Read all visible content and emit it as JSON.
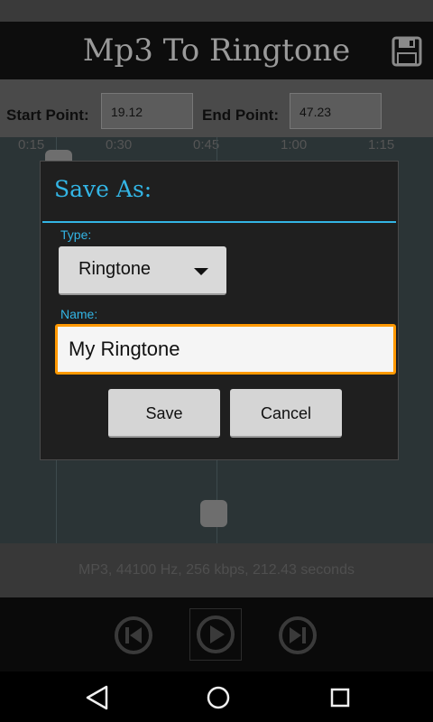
{
  "app": {
    "title": "Mp3 To Ringtone",
    "save_icon": "floppy-disk-icon"
  },
  "points": {
    "start_label": "Start Point:",
    "start_value": "19.12",
    "end_label": "End Point:",
    "end_value": "47.23"
  },
  "timeline": {
    "ticks": [
      "0:15",
      "0:30",
      "0:45",
      "1:00",
      "1:15"
    ]
  },
  "file_info": "MP3, 44100 Hz, 256 kbps, 212.43 seconds",
  "dialog": {
    "title": "Save As:",
    "type_label": "Type:",
    "type_value": "Ringtone",
    "name_label": "Name:",
    "name_value": "My Ringtone",
    "save_label": "Save",
    "cancel_label": "Cancel"
  },
  "controls": {
    "prev_icon": "skip-previous-icon",
    "play_icon": "play-icon",
    "next_icon": "skip-next-icon"
  },
  "nav": {
    "back_icon": "back-triangle-icon",
    "home_icon": "home-circle-icon",
    "recents_icon": "recents-square-icon"
  },
  "colors": {
    "accent": "#33b5e5",
    "input_focus": "#ff9900"
  }
}
